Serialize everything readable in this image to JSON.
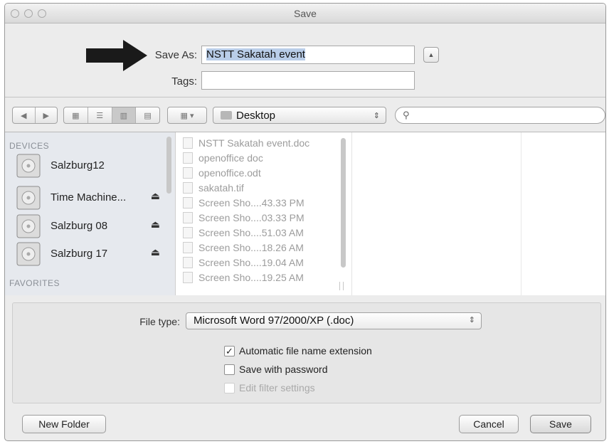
{
  "window": {
    "title": "Save"
  },
  "save": {
    "save_as_label": "Save As:",
    "filename_value": "NSTT Sakatah event",
    "tags_label": "Tags:",
    "tags_value": "",
    "expand_icon": "triangle-up-icon"
  },
  "toolbar": {
    "location": "Desktop",
    "view_icons": [
      "icon-view-icon",
      "list-view-icon",
      "column-view-icon",
      "coverflow-view-icon"
    ],
    "arrange_icon": "arrange-icon",
    "search_placeholder": ""
  },
  "sidebar": {
    "devices_heading": "DEVICES",
    "favorites_heading": "FAVORITES",
    "devices": [
      {
        "name": "Salzburg12",
        "eject": false
      },
      {
        "name": "Time Machine...",
        "eject": true
      },
      {
        "name": "Salzburg 08",
        "eject": true
      },
      {
        "name": "Salzburg 17",
        "eject": true
      }
    ]
  },
  "files": [
    "NSTT Sakatah event.doc",
    "openoffice doc",
    "openoffice.odt",
    "sakatah.tif",
    "Screen Sho....43.33 PM",
    "Screen Sho....03.33 PM",
    "Screen Sho....51.03 AM",
    "Screen Sho....18.26 AM",
    "Screen Sho....19.04 AM",
    "Screen Sho....19.25 AM"
  ],
  "options": {
    "file_type_label": "File type:",
    "file_type_value": "Microsoft Word 97/2000/XP (.doc)",
    "automatic_extension": {
      "label": "Automatic file name extension",
      "checked": true
    },
    "save_with_password": {
      "label": "Save with password",
      "checked": false
    },
    "edit_filter_settings": {
      "label": "Edit filter settings",
      "checked": false,
      "disabled": true
    }
  },
  "buttons": {
    "new_folder": "New Folder",
    "cancel": "Cancel",
    "save": "Save"
  },
  "colors": {
    "selection": "#b9cde8",
    "arrow": "#1a1a1a"
  }
}
